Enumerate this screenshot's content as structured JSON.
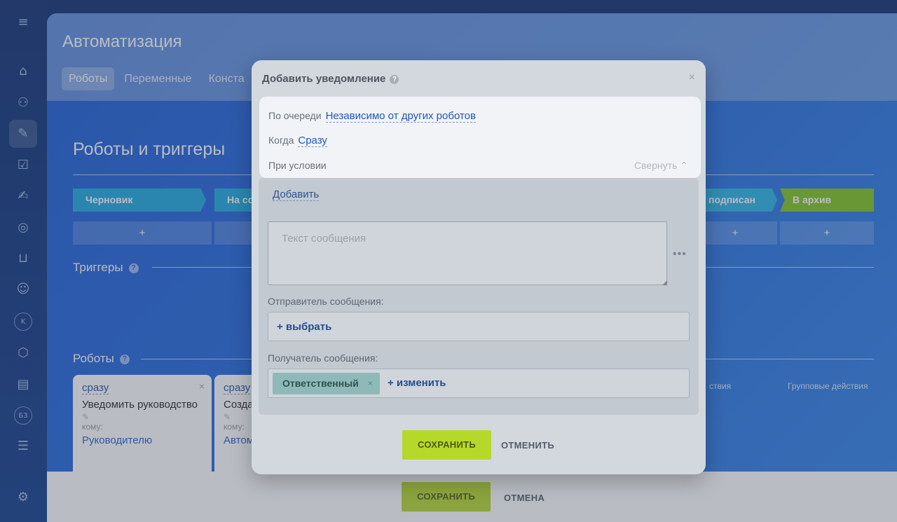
{
  "rail": {
    "icons": [
      "menu-icon",
      "home-icon",
      "workflow-icon",
      "pen-icon",
      "checkbox-icon",
      "document-edit-icon",
      "target-icon",
      "cart-icon",
      "robot-icon",
      "company-k-icon",
      "box-icon",
      "contact-card-icon",
      "kb-icon",
      "filter-icon",
      "settings-icon"
    ],
    "k_label": "K",
    "kb_label": "БЗ"
  },
  "slider": {
    "title": "Автоматизация",
    "tabs": [
      {
        "label": "Роботы",
        "active": true
      },
      {
        "label": "Переменные",
        "active": false
      },
      {
        "label": "Конста",
        "active": false
      }
    ],
    "section_title": "Роботы и триггеры",
    "stages": [
      "Черновик",
      "На со",
      "подписан",
      "В архив"
    ],
    "plus": "+",
    "triggers_label": "Триггеры",
    "robots_label": "Роботы",
    "help": "?",
    "group_actions": [
      "ствия",
      "Групповые действия"
    ],
    "cards": [
      {
        "when": "сразу",
        "name": "Уведомить руководство",
        "whom": "кому:",
        "target": "Руководителю",
        "close": "×"
      },
      {
        "when": "сразу",
        "name": "Созда",
        "whom": "кому:",
        "target": "Автом",
        "close": ""
      }
    ],
    "save_label": "СОХРАНИТЬ",
    "cancel_label": "ОТМЕНА"
  },
  "popup": {
    "title": "Добавить уведомление",
    "help": "?",
    "close": "×",
    "order_label": "По очереди",
    "order_value": "Независимо от других роботов",
    "when_label": "Когда",
    "when_value": "Сразу",
    "condition_label": "При условии",
    "collapse_label": "Свернуть",
    "add_label": "Добавить",
    "message_placeholder": "Текст сообщения",
    "more": "•••",
    "sender_label": "Отправитель сообщения:",
    "sender_select": "+ выбрать",
    "recipient_label": "Получатель сообщения:",
    "recipient_chip": "Ответственный",
    "chip_remove": "×",
    "recipient_change": "+ изменить",
    "save_label": "СОХРАНИТЬ",
    "cancel_label": "ОТМЕНИТЬ"
  }
}
